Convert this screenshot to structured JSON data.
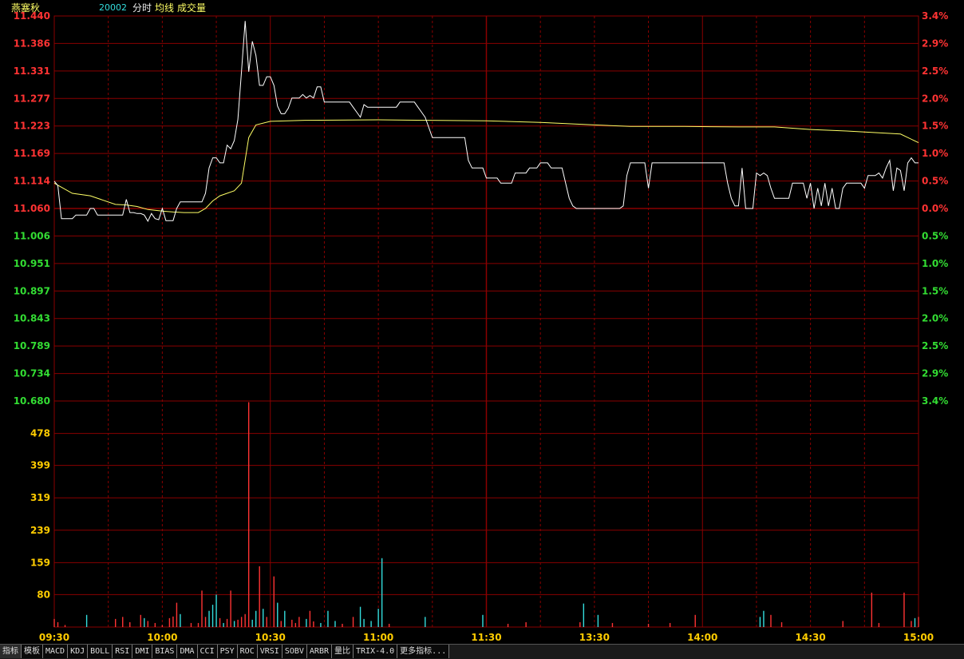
{
  "header": {
    "stock_name": "燕塞秋",
    "stock_code": "20002",
    "view_label": "分时",
    "avg_label": "均线",
    "vol_label": "成交量"
  },
  "colors": {
    "grid": "#8a0000",
    "up": "#ff3333",
    "down": "#33dd33",
    "price_line": "#ffffff",
    "avg_line": "#ffff66",
    "vol_up": "#ff3333",
    "vol_down": "#33dddd",
    "axis_text_neutral": "#ff9999"
  },
  "tabs": [
    "指标",
    "模板",
    "MACD",
    "KDJ",
    "BOLL",
    "RSI",
    "DMI",
    "BIAS",
    "DMA",
    "CCI",
    "PSY",
    "ROC",
    "VRSI",
    "SOBV",
    "ARBR",
    "量比",
    "TRIX-4.0",
    "更多指标..."
  ],
  "chart_data": {
    "type": "line",
    "title": "",
    "price_axis_labels": [
      "11.440",
      "11.386",
      "11.331",
      "11.277",
      "11.223",
      "11.169",
      "11.114",
      "11.060",
      "11.006",
      "10.951",
      "10.897",
      "10.843",
      "10.789",
      "10.734",
      "10.680"
    ],
    "pct_axis_labels": [
      "3.4%",
      "2.9%",
      "2.5%",
      "2.0%",
      "1.5%",
      "1.0%",
      "0.5%",
      "0.0%",
      "0.5%",
      "1.0%",
      "1.5%",
      "2.0%",
      "2.5%",
      "2.9%",
      "3.4%"
    ],
    "prev_close": 11.06,
    "price_ylim": [
      10.68,
      11.44
    ],
    "volume_axis_labels": [
      "478",
      "399",
      "319",
      "239",
      "159",
      "80"
    ],
    "volume_ylim": [
      0,
      558
    ],
    "time_labels": [
      "09:30",
      "10:00",
      "10:30",
      "11:00",
      "11:30",
      "13:30",
      "14:00",
      "14:30",
      "15:00"
    ],
    "series": [
      {
        "name": "分时",
        "x": [
          0,
          1,
          2,
          3,
          4,
          5,
          6,
          7,
          8,
          9,
          10,
          11,
          12,
          13,
          14,
          15,
          16,
          17,
          18,
          19,
          20,
          21,
          22,
          23,
          24,
          25,
          26,
          27,
          28,
          29,
          30,
          31,
          32,
          33,
          34,
          35,
          36,
          37,
          38,
          39,
          40,
          41,
          42,
          43,
          44,
          45,
          46,
          47,
          48,
          49,
          50,
          51,
          52,
          53,
          54,
          55,
          56,
          57,
          58,
          59,
          60,
          61,
          62,
          63,
          64,
          65,
          66,
          67,
          68,
          69,
          70,
          71,
          72,
          73,
          74,
          75,
          76,
          77,
          78,
          79,
          80,
          81,
          82,
          83,
          84,
          85,
          86,
          87,
          88,
          89,
          90,
          91,
          92,
          93,
          94,
          95,
          96,
          97,
          98,
          99,
          100,
          101,
          102,
          103,
          104,
          105,
          106,
          107,
          108,
          109,
          110,
          111,
          112,
          113,
          114,
          115,
          116,
          117,
          118,
          119,
          120,
          121,
          122,
          123,
          124,
          125,
          126,
          127,
          128,
          129,
          130,
          131,
          132,
          133,
          134,
          135,
          136,
          137,
          138,
          139,
          140,
          141,
          142,
          143,
          144,
          145,
          146,
          147,
          148,
          149,
          150,
          151,
          152,
          153,
          154,
          155,
          156,
          157,
          158,
          159,
          160,
          161,
          162,
          163,
          164,
          165,
          166,
          167,
          168,
          169,
          170,
          171,
          172,
          173,
          174,
          175,
          176,
          177,
          178,
          179,
          180,
          181,
          182,
          183,
          184,
          185,
          186,
          187,
          188,
          189,
          190,
          191,
          192,
          193,
          194,
          195,
          196,
          197,
          198,
          199,
          200,
          201,
          202,
          203,
          204,
          205,
          206,
          207,
          208,
          209,
          210,
          211,
          212,
          213,
          214,
          215,
          216,
          217,
          218,
          219,
          220,
          221,
          222,
          223,
          224,
          225,
          226,
          227,
          228,
          229,
          230,
          231,
          232,
          233,
          234,
          235,
          236,
          237,
          238,
          239,
          240
        ],
        "values": [
          11.114,
          11.105,
          11.04,
          11.04,
          11.04,
          11.04,
          11.047,
          11.047,
          11.047,
          11.047,
          11.06,
          11.06,
          11.047,
          11.047,
          11.047,
          11.047,
          11.047,
          11.047,
          11.047,
          11.047,
          11.078,
          11.052,
          11.052,
          11.05,
          11.05,
          11.047,
          11.035,
          11.05,
          11.04,
          11.038,
          11.06,
          11.036,
          11.036,
          11.036,
          11.06,
          11.073,
          11.073,
          11.073,
          11.073,
          11.073,
          11.073,
          11.073,
          11.09,
          11.14,
          11.16,
          11.16,
          11.15,
          11.15,
          11.185,
          11.178,
          11.194,
          11.236,
          11.33,
          11.43,
          11.33,
          11.39,
          11.362,
          11.303,
          11.303,
          11.32,
          11.32,
          11.303,
          11.262,
          11.247,
          11.247,
          11.258,
          11.278,
          11.278,
          11.278,
          11.285,
          11.278,
          11.283,
          11.278,
          11.3,
          11.3,
          11.27,
          11.27,
          11.27,
          11.27,
          11.27,
          11.27,
          11.27,
          11.27,
          11.26,
          11.25,
          11.24,
          11.265,
          11.26,
          11.26,
          11.26,
          11.26,
          11.26,
          11.26,
          11.26,
          11.26,
          11.26,
          11.27,
          11.27,
          11.27,
          11.27,
          11.27,
          11.26,
          11.25,
          11.24,
          11.22,
          11.2,
          11.2,
          11.2,
          11.2,
          11.2,
          11.2,
          11.2,
          11.2,
          11.2,
          11.2,
          11.155,
          11.14,
          11.14,
          11.14,
          11.14,
          11.12,
          11.12,
          11.12,
          11.12,
          11.11,
          11.11,
          11.11,
          11.11,
          11.13,
          11.13,
          11.13,
          11.13,
          11.14,
          11.14,
          11.14,
          11.15,
          11.15,
          11.15,
          11.14,
          11.14,
          11.14,
          11.14,
          11.11,
          11.08,
          11.065,
          11.06,
          11.06,
          11.06,
          11.06,
          11.06,
          11.06,
          11.06,
          11.06,
          11.06,
          11.06,
          11.06,
          11.06,
          11.06,
          11.065,
          11.125,
          11.15,
          11.15,
          11.15,
          11.15,
          11.15,
          11.1,
          11.15,
          11.15,
          11.15,
          11.15,
          11.15,
          11.15,
          11.15,
          11.15,
          11.15,
          11.15,
          11.15,
          11.15,
          11.15,
          11.15,
          11.15,
          11.15,
          11.15,
          11.15,
          11.15,
          11.15,
          11.15,
          11.11,
          11.08,
          11.065,
          11.065,
          11.14,
          11.06,
          11.06,
          11.06,
          11.13,
          11.125,
          11.13,
          11.125,
          11.1,
          11.08,
          11.08,
          11.08,
          11.08,
          11.08,
          11.11,
          11.11,
          11.11,
          11.11,
          11.08,
          11.11,
          11.06,
          11.1,
          11.065,
          11.11,
          11.065,
          11.1,
          11.06,
          11.06,
          11.1,
          11.11,
          11.11,
          11.11,
          11.11,
          11.11,
          11.1,
          11.125,
          11.125,
          11.125,
          11.13,
          11.12,
          11.14,
          11.155,
          11.095,
          11.14,
          11.135,
          11.095,
          11.15,
          11.16,
          11.15,
          11.15
        ]
      },
      {
        "name": "均线",
        "x": [
          0,
          5,
          10,
          17,
          20,
          23,
          26,
          30,
          33,
          36,
          40,
          42,
          44,
          46,
          50,
          52,
          54,
          56,
          60,
          70,
          90,
          120,
          135,
          150,
          160,
          175,
          190,
          200,
          210,
          220,
          235,
          240
        ],
        "values": [
          11.11,
          11.09,
          11.085,
          11.068,
          11.067,
          11.064,
          11.058,
          11.055,
          11.053,
          11.052,
          11.052,
          11.06,
          11.075,
          11.085,
          11.095,
          11.11,
          11.2,
          11.225,
          11.232,
          11.234,
          11.235,
          11.233,
          11.23,
          11.225,
          11.222,
          11.222,
          11.221,
          11.221,
          11.216,
          11.213,
          11.207,
          11.19
        ]
      }
    ],
    "volume": {
      "x": [
        0,
        1,
        3,
        9,
        17,
        19,
        21,
        24,
        25,
        26,
        28,
        30,
        32,
        33,
        34,
        35,
        38,
        40,
        41,
        42,
        43,
        44,
        45,
        46,
        47,
        48,
        49,
        50,
        51,
        52,
        53,
        54,
        55,
        56,
        57,
        58,
        59,
        61,
        62,
        63,
        64,
        66,
        67,
        68,
        70,
        71,
        72,
        74,
        76,
        78,
        80,
        83,
        85,
        86,
        88,
        90,
        91,
        93,
        103,
        119,
        126,
        131,
        146,
        147,
        151,
        155,
        165,
        171,
        178,
        196,
        197,
        199,
        202,
        219,
        227,
        229,
        236,
        238,
        239,
        240
      ],
      "values": [
        20,
        12,
        5,
        30,
        20,
        25,
        12,
        30,
        22,
        15,
        10,
        5,
        22,
        26,
        60,
        32,
        10,
        10,
        90,
        25,
        40,
        55,
        80,
        22,
        10,
        20,
        90,
        15,
        18,
        25,
        32,
        555,
        18,
        40,
        150,
        45,
        25,
        125,
        60,
        15,
        40,
        18,
        10,
        25,
        20,
        40,
        14,
        10,
        40,
        15,
        8,
        25,
        50,
        20,
        15,
        45,
        170,
        8,
        25,
        30,
        8,
        12,
        12,
        58,
        30,
        10,
        8,
        10,
        30,
        25,
        40,
        30,
        12,
        15,
        85,
        10,
        85,
        15,
        22,
        25
      ],
      "colors_up": [
        true,
        true,
        true,
        false,
        true,
        true,
        true,
        true,
        false,
        true,
        true,
        true,
        true,
        true,
        true,
        false,
        true,
        true,
        true,
        true,
        false,
        false,
        false,
        true,
        false,
        true,
        true,
        false,
        true,
        true,
        true,
        true,
        false,
        false,
        true,
        false,
        true,
        true,
        false,
        true,
        false,
        true,
        true,
        true,
        false,
        true,
        true,
        false,
        false,
        false,
        true,
        true,
        false,
        false,
        false,
        false,
        false,
        true,
        false,
        false,
        true,
        true,
        true,
        false,
        false,
        true,
        true,
        true,
        true,
        false,
        false,
        true,
        true,
        true,
        true,
        true,
        true,
        true,
        false,
        true
      ]
    }
  }
}
